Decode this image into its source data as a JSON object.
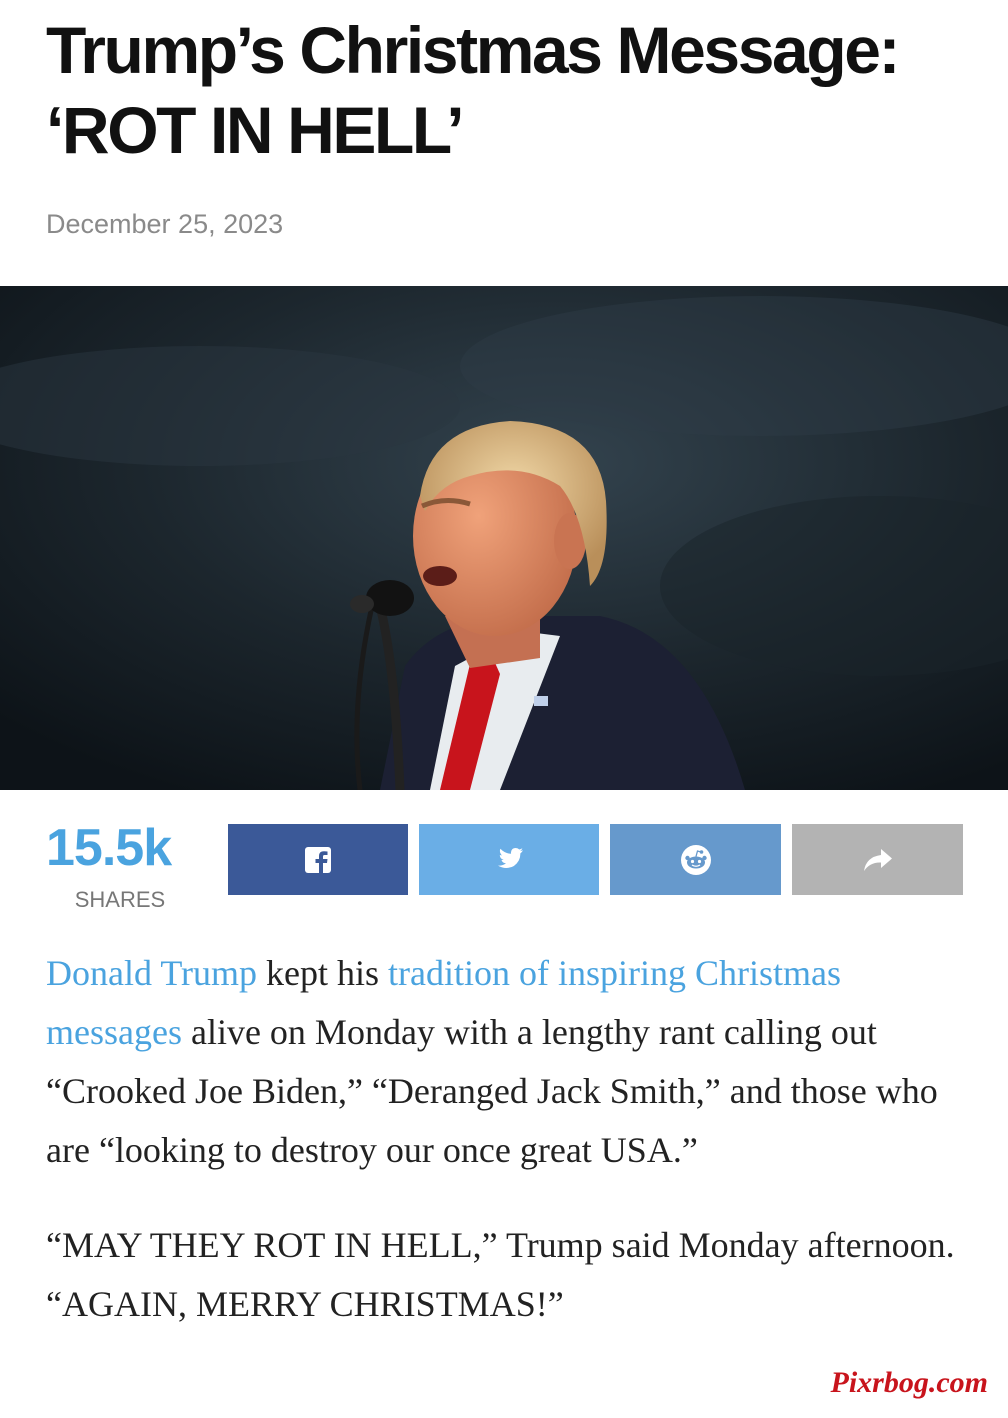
{
  "article": {
    "title": "Trump’s Christmas Message: ‘ROT IN HELL’",
    "date": "December 25, 2023",
    "paragraph1": {
      "link1": "Donald Trump",
      "text1": " kept his ",
      "link2": "tradition of inspiring Christmas messages",
      "text2": " alive on Monday with a lengthy rant calling out “Crooked Joe Biden,” “Deranged Jack Smith,” and those who are “looking to destroy our once great USA.”"
    },
    "paragraph2": "“MAY THEY ROT IN HELL,” Trump said Monday afternoon. “AGAIN, MERRY CHRISTMAS!”"
  },
  "share_bar": {
    "count": "15.5k",
    "label": "SHARES",
    "buttons": [
      {
        "icon": "facebook-icon",
        "color": "#3b5998"
      },
      {
        "icon": "twitter-icon",
        "color": "#6aaee6"
      },
      {
        "icon": "reddit-icon",
        "color": "#6699cc"
      },
      {
        "icon": "share-arrow-icon",
        "color": "#b3b3b3"
      }
    ]
  },
  "watermark": "Pixrbog.com",
  "colors": {
    "link": "#4aa3df",
    "headline": "#111111",
    "date": "#8a8a8a"
  }
}
